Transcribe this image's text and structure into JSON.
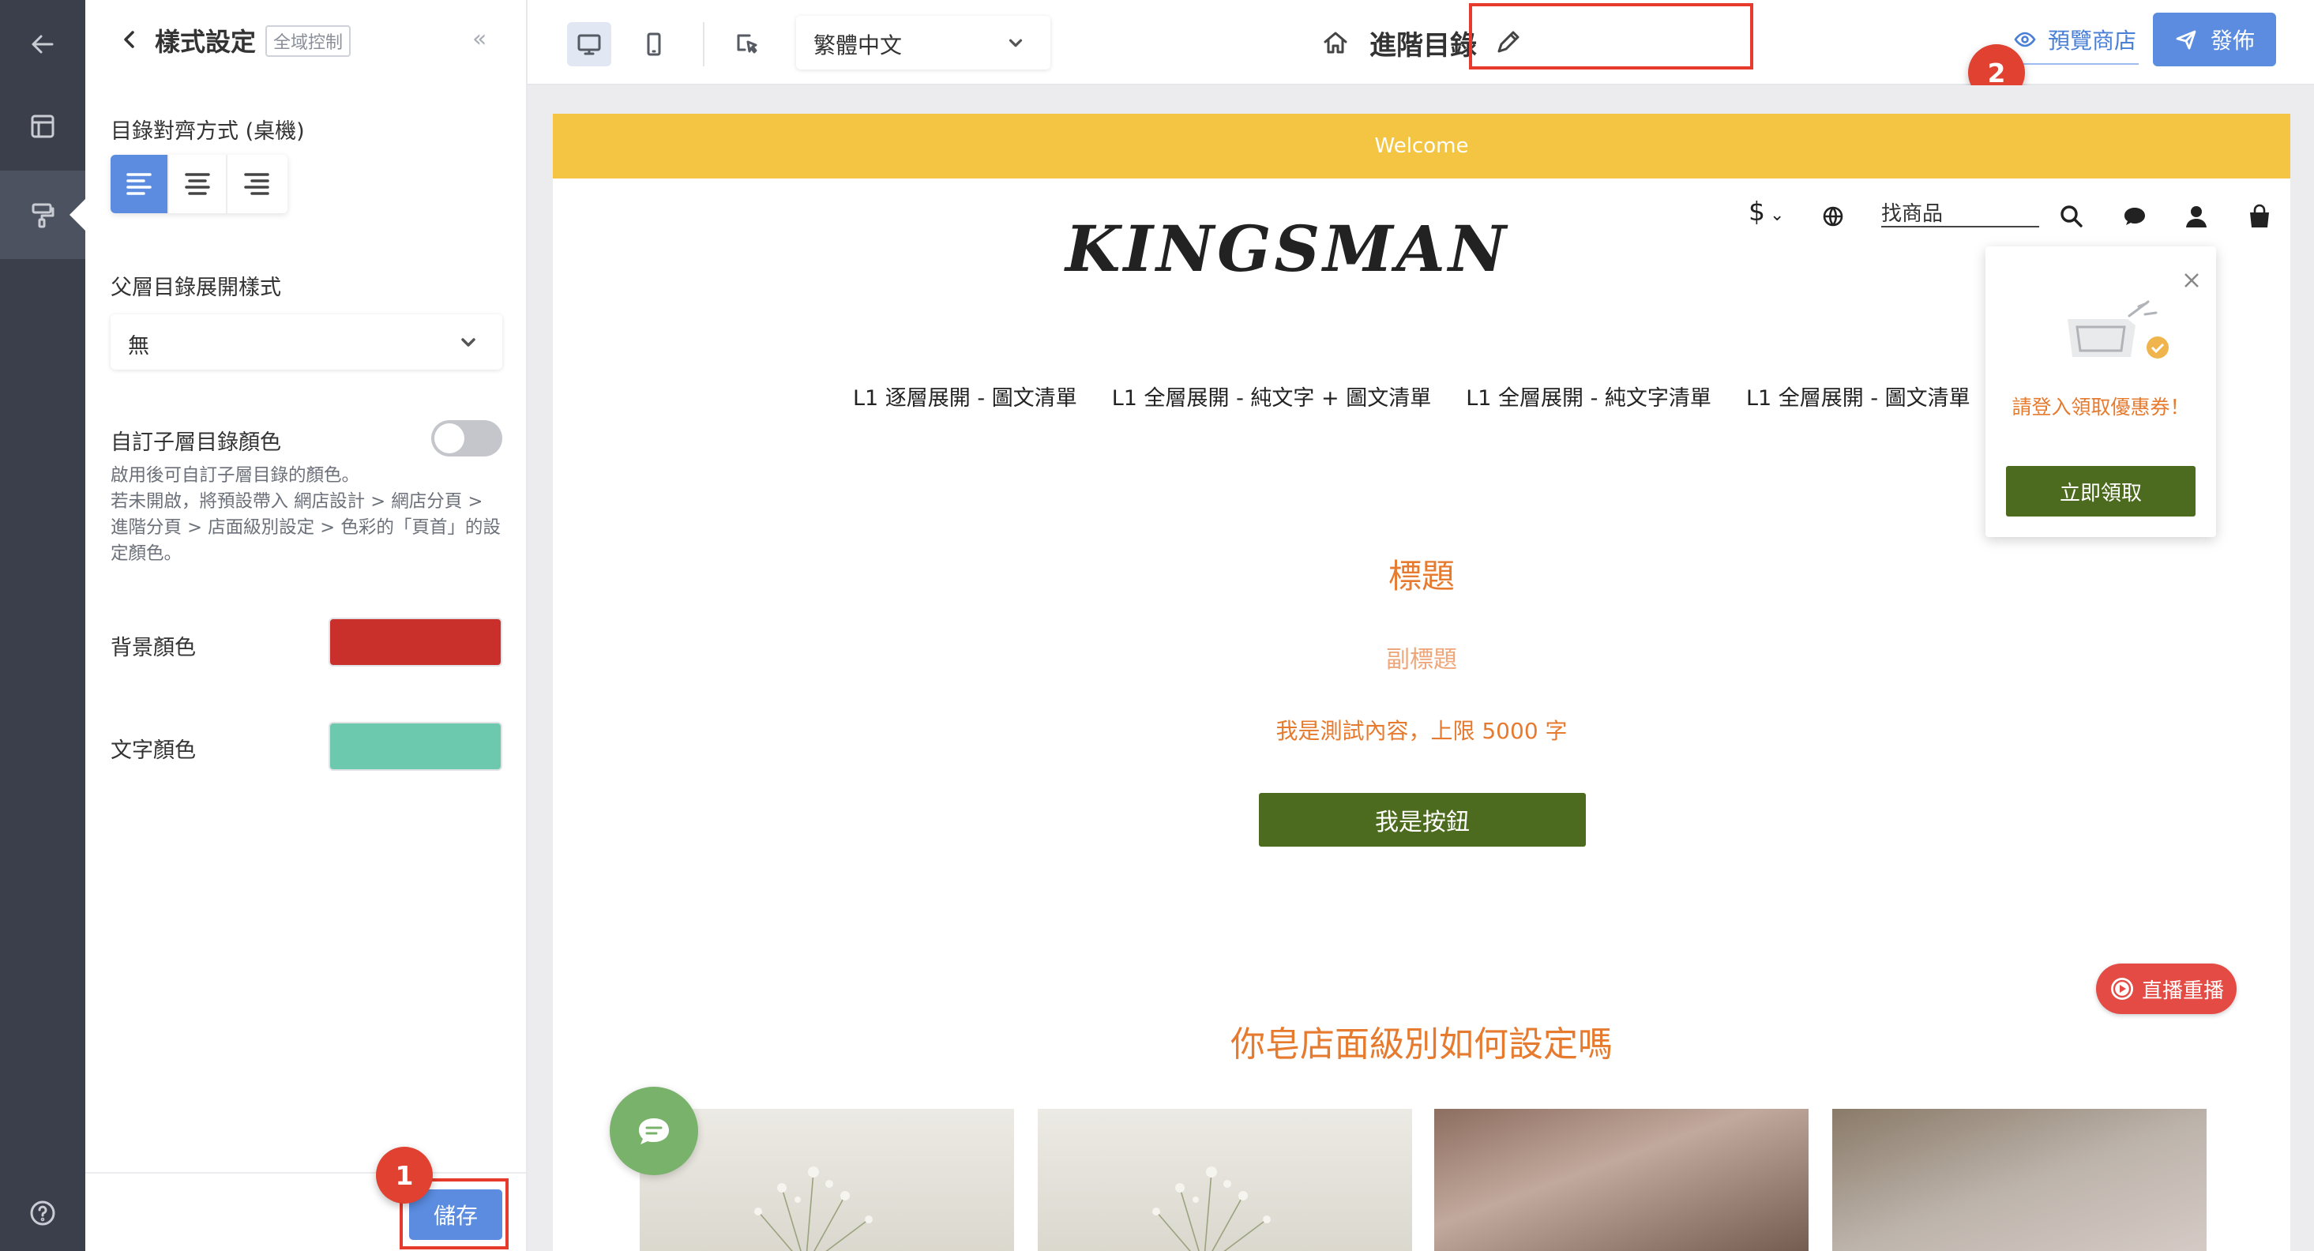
{
  "panel": {
    "title": "樣式設定",
    "scope_tag": "全域控制",
    "collapse_glyph": "«",
    "align_label": "目錄對齊方式 (桌機)",
    "align_options": [
      "left",
      "center",
      "right"
    ],
    "align_selected": "left",
    "expand_label": "父層目錄展開樣式",
    "expand_value": "無",
    "custom_color_label": "自訂子層目錄顏色",
    "custom_color_enabled": false,
    "help_text": "啟用後可自訂子層目錄的顏色。\n若未開啟，將預設帶入 網店設計 > 網店分頁 > 進階分頁 > 店面級別設定 > 色彩的「頁首」的設定顏色。",
    "bg_color_label": "背景顏色",
    "bg_color": "#c9302c",
    "text_color_label": "文字顏色",
    "text_color": "#6dc9ae",
    "save_label": "儲存",
    "save_step": "1"
  },
  "toolbar": {
    "language": "繁體中文",
    "page_title": "進階目錄",
    "preview_label": "預覽商店",
    "publish_label": "發佈",
    "publish_step": "2"
  },
  "store": {
    "announcement": "Welcome",
    "currency": "$",
    "search_placeholder": "找商品",
    "logo_text": "KINGSMAN",
    "nav_items": [
      "L1 逐層展開 - 圖文清單",
      "L1 全層展開 - 純文字 + 圖文清單",
      "L1 全層展開 - 純文字清單",
      "L1 全層展開 - 圖文清單"
    ],
    "hero": {
      "title": "標題",
      "subtitle": "副標題",
      "body": "我是測試內容，上限 5000 字",
      "button": "我是按鈕"
    },
    "section_title": "你皂店面級別如何設定嗎",
    "live_badge": "直播重播",
    "coupon": {
      "text": "請登入領取優惠券！",
      "button": "立即領取"
    }
  },
  "colors": {
    "accent_blue": "#5b8ce0",
    "brand_green": "#4d6b1e",
    "title_orange": "#e67b2f",
    "announce_yellow": "#f4c542",
    "highlight_red": "#e53a2c"
  }
}
